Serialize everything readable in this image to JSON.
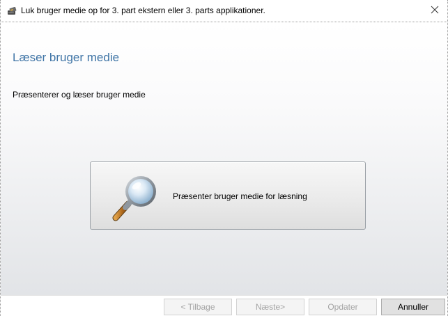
{
  "window": {
    "title": "Luk bruger medie op for 3. part ekstern eller 3. parts applikationer.",
    "app_icon": "card-reader-icon",
    "close_icon": "close-icon"
  },
  "main": {
    "heading": "Læser bruger medie",
    "description": "Præsenterer og læser bruger medie",
    "present_button": {
      "label": "Præsenter bruger medie for læsning",
      "icon": "magnifier-icon"
    }
  },
  "footer": {
    "back_label": "< Tilbage",
    "next_label": "Næste>",
    "update_label": "Opdater",
    "cancel_label": "Annuller"
  },
  "colors": {
    "heading": "#3f74a6",
    "disabled_text": "#a4a4a4",
    "content_gradient_bottom": "#e2e4e7"
  }
}
